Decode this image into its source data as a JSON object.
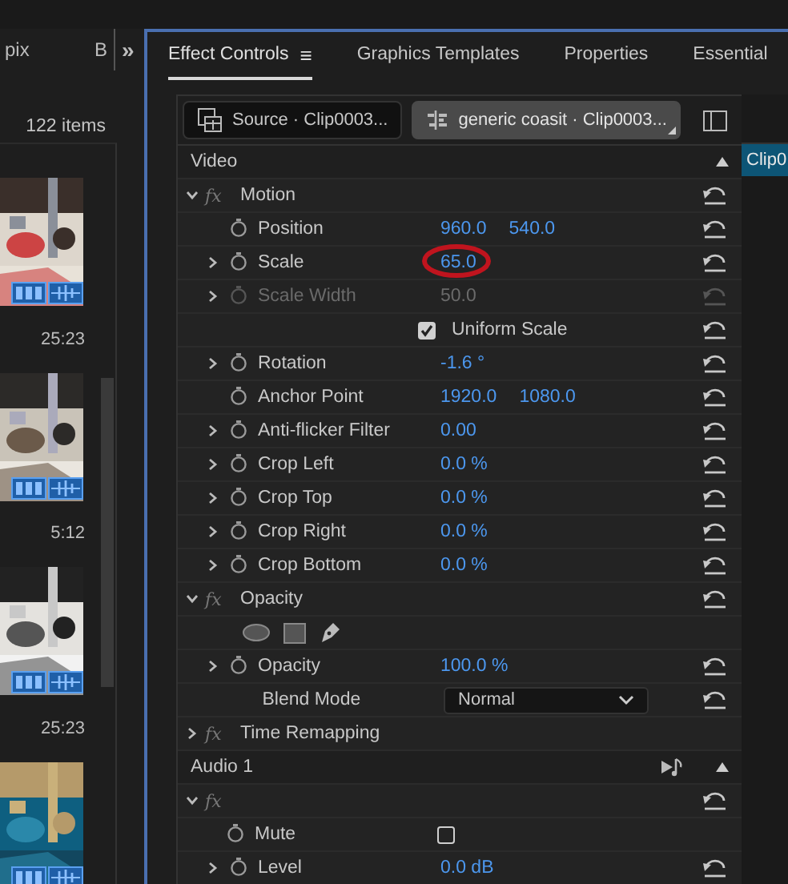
{
  "left_panel": {
    "tabs": [
      {
        "label": "pix"
      },
      {
        "label": "B"
      }
    ],
    "overflow": "»",
    "item_count": "122 items",
    "clips": [
      {
        "kind": "picture",
        "duration": "25:23"
      },
      {
        "kind": "picture",
        "duration": "5:12"
      },
      {
        "kind": "picture",
        "duration": "25:23"
      },
      {
        "kind": "picture"
      }
    ]
  },
  "tabs": [
    {
      "label": "Effect Controls",
      "selected": true,
      "menu": "≡"
    },
    {
      "label": "Graphics Templates",
      "selected": false
    },
    {
      "label": "Properties",
      "selected": false
    },
    {
      "label": "Essential",
      "selected": false
    }
  ],
  "source_chips": [
    {
      "kind": "source",
      "label": "Source · Clip0003...",
      "selected": false
    },
    {
      "kind": "sequence",
      "label": "generic coasit · Clip0003...",
      "selected": true
    }
  ],
  "timeline": {
    "clip": "Clip0"
  },
  "rows": [
    {
      "kind": "section",
      "label": "Video"
    },
    {
      "kind": "group",
      "label": "Motion",
      "fx": "fx",
      "expanded": true
    },
    {
      "kind": "param",
      "label": "Position",
      "values": [
        "960.0",
        "540.0"
      ],
      "expandable": false,
      "disabled": false
    },
    {
      "kind": "param",
      "label": "Scale",
      "values": [
        "65.0"
      ],
      "expandable": true,
      "disabled": false,
      "circled": true
    },
    {
      "kind": "param",
      "label": "Scale Width",
      "values": [
        "50.0"
      ],
      "expandable": true,
      "disabled": true
    },
    {
      "kind": "checkbox",
      "label": "Uniform Scale",
      "checked": true
    },
    {
      "kind": "param",
      "label": "Rotation",
      "values": [
        "-1.6 °"
      ],
      "expandable": true,
      "disabled": false
    },
    {
      "kind": "param",
      "label": "Anchor Point",
      "values": [
        "1920.0",
        "1080.0"
      ],
      "expandable": false,
      "disabled": false
    },
    {
      "kind": "param",
      "label": "Anti-flicker Filter",
      "values": [
        "0.00"
      ],
      "expandable": true,
      "disabled": false
    },
    {
      "kind": "param",
      "label": "Crop Left",
      "values": [
        "0.0 %"
      ],
      "expandable": true,
      "disabled": false
    },
    {
      "kind": "param",
      "label": "Crop Top",
      "values": [
        "0.0 %"
      ],
      "expandable": true,
      "disabled": false
    },
    {
      "kind": "param",
      "label": "Crop Right",
      "values": [
        "0.0 %"
      ],
      "expandable": true,
      "disabled": false
    },
    {
      "kind": "param",
      "label": "Crop Bottom",
      "values": [
        "0.0 %"
      ],
      "expandable": true,
      "disabled": false
    },
    {
      "kind": "group",
      "label": "Opacity",
      "fx": "fx",
      "expanded": true
    },
    {
      "kind": "masks"
    },
    {
      "kind": "param",
      "label": "Opacity",
      "values": [
        "100.0 %"
      ],
      "expandable": true,
      "disabled": false
    },
    {
      "kind": "dropdown",
      "label": "Blend Mode",
      "value": "Normal"
    },
    {
      "kind": "group",
      "label": "Time Remapping",
      "fx": "fx",
      "expanded": false,
      "no_reset": true
    },
    {
      "kind": "section",
      "label": "Audio 1",
      "audio": true
    },
    {
      "kind": "group",
      "fx": "fx",
      "expanded": true
    },
    {
      "kind": "mute",
      "label": "Mute",
      "checked": false
    },
    {
      "kind": "param",
      "label": "Level",
      "values": [
        "0.0 dB"
      ],
      "expandable": true,
      "disabled": false
    }
  ]
}
